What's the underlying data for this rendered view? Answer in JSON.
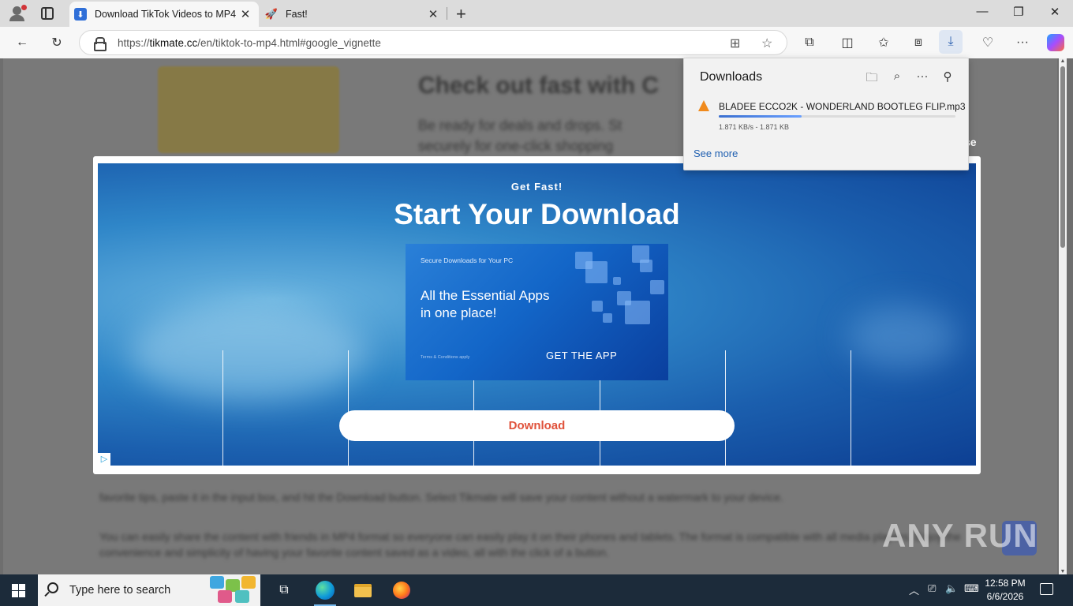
{
  "tabs": [
    {
      "title": "Download TikTok Videos to MP4 -",
      "active": true,
      "icon": "download-favicon"
    },
    {
      "title": "Fast!",
      "active": false,
      "icon": "rocket-favicon"
    }
  ],
  "address_bar": {
    "url_prefix": "https://",
    "url_domain": "tikmate.cc",
    "url_path": "/en/tiktok-to-mp4.html#google_vignette"
  },
  "page_background": {
    "heading": "Check out fast with C",
    "paragraph_line1": "Be ready for deals and drops. St",
    "paragraph_line2": "securely for one-click shopping",
    "close_text": "se",
    "body_text_1": "favorite tips, paste it in the input box, and hit the Download button. Select Tikmate will save your content without a watermark to your device.",
    "body_text_2": "You can easily share the content with friends in MP4 format so everyone can easily play it on their phones and tablets. The format is compatible with all media players. Enjoy the convenience and simplicity of having your favorite content saved as a video, all with the click of a button."
  },
  "ad": {
    "kicker": "Get Fast!",
    "headline": "Start Your Download",
    "banner_small": "Secure Downloads for Your PC",
    "banner_line1": "All the Essential Apps",
    "banner_line2": "in one place!",
    "banner_terms": "Terms & Conditions apply",
    "banner_cta": "GET THE APP",
    "download_button": "Download",
    "adchoices_icon": "▷"
  },
  "downloads_panel": {
    "title": "Downloads",
    "file_name": "BLADEE ECCO2K - WONDERLAND BOOTLEG FLIP.mp3",
    "status": "1.871 KB/s - 1.871 KB",
    "progress_fraction": 0.35,
    "see_more": "See more"
  },
  "taskbar": {
    "search_placeholder": "Type here to search",
    "time": "12:58 PM",
    "date": "6/6/2026"
  },
  "watermark": "ANY RUN",
  "colors": {
    "accent": "#2a5fb0",
    "download_button_text": "#e0523b",
    "vlc_orange": "#f08a1c"
  }
}
